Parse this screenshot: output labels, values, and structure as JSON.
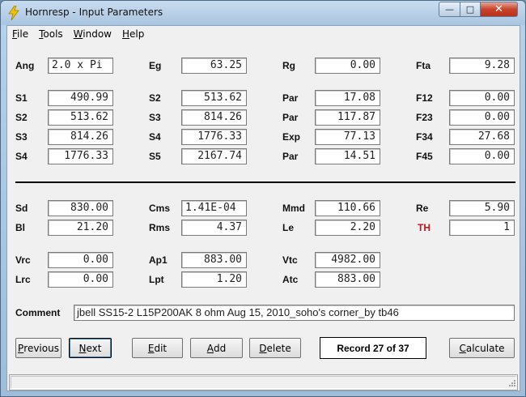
{
  "window": {
    "title": "Hornresp - Input Parameters",
    "min_symbol": "—",
    "max_symbol": "□",
    "close_symbol": "✕"
  },
  "menu": [
    {
      "underline": "F",
      "rest": "ile"
    },
    {
      "underline": "T",
      "rest": "ools"
    },
    {
      "underline": "W",
      "rest": "indow"
    },
    {
      "underline": "H",
      "rest": "elp"
    }
  ],
  "top": {
    "row1": [
      {
        "label": "Ang",
        "value": "2.0 x Pi"
      },
      {
        "label": "Eg",
        "value": "63.25"
      },
      {
        "label": "Rg",
        "value": "0.00"
      },
      {
        "label": "Fta",
        "value": "9.28"
      }
    ],
    "rows": [
      [
        {
          "label": "S1",
          "value": "490.99"
        },
        {
          "label": "S2",
          "value": "513.62"
        },
        {
          "label": "Par",
          "value": "17.08"
        },
        {
          "label": "F12",
          "value": "0.00"
        }
      ],
      [
        {
          "label": "S2",
          "value": "513.62"
        },
        {
          "label": "S3",
          "value": "814.26"
        },
        {
          "label": "Par",
          "value": "117.87"
        },
        {
          "label": "F23",
          "value": "0.00"
        }
      ],
      [
        {
          "label": "S3",
          "value": "814.26"
        },
        {
          "label": "S4",
          "value": "1776.33"
        },
        {
          "label": "Exp",
          "value": "77.13"
        },
        {
          "label": "F34",
          "value": "27.68"
        }
      ],
      [
        {
          "label": "S4",
          "value": "1776.33"
        },
        {
          "label": "S5",
          "value": "2167.74"
        },
        {
          "label": "Par",
          "value": "14.51"
        },
        {
          "label": "F45",
          "value": "0.00"
        }
      ]
    ]
  },
  "driver": {
    "rows": [
      [
        {
          "label": "Sd",
          "value": "830.00"
        },
        {
          "label": "Cms",
          "value": "1.41E-04"
        },
        {
          "label": "Mmd",
          "value": "110.66"
        },
        {
          "label": "Re",
          "value": "5.90"
        }
      ],
      [
        {
          "label": "Bl",
          "value": "21.20"
        },
        {
          "label": "Rms",
          "value": "4.37"
        },
        {
          "label": "Le",
          "value": "2.20"
        },
        {
          "label": "TH",
          "value": "1"
        }
      ]
    ],
    "chamber": [
      [
        {
          "label": "Vrc",
          "value": "0.00"
        },
        {
          "label": "Ap1",
          "value": "883.00"
        },
        {
          "label": "Vtc",
          "value": "4982.00"
        }
      ],
      [
        {
          "label": "Lrc",
          "value": "0.00"
        },
        {
          "label": "Lpt",
          "value": "1.20"
        },
        {
          "label": "Atc",
          "value": "883.00"
        }
      ]
    ]
  },
  "comment": {
    "label": "Comment",
    "value": "jbell SS15-2 L15P200AK 8 ohm Aug 15, 2010_soho's corner_by tb46"
  },
  "buttons": {
    "previous": {
      "underline": "P",
      "rest": "revious"
    },
    "next": {
      "underline": "N",
      "rest": "ext"
    },
    "edit": {
      "underline": "E",
      "rest": "dit"
    },
    "add": {
      "underline": "A",
      "rest": "dd"
    },
    "delete": {
      "underline": "D",
      "rest": "elete"
    },
    "calculate": {
      "underline": "C",
      "rest": "alculate"
    }
  },
  "record": "Record 27 of 37",
  "colors": {
    "th_label": "#c0141e",
    "title_bar": "#b9d1ea",
    "close_button": "#c7432c"
  },
  "icons": {
    "app": "lightning-icon",
    "grip": "resize-grip-icon"
  }
}
